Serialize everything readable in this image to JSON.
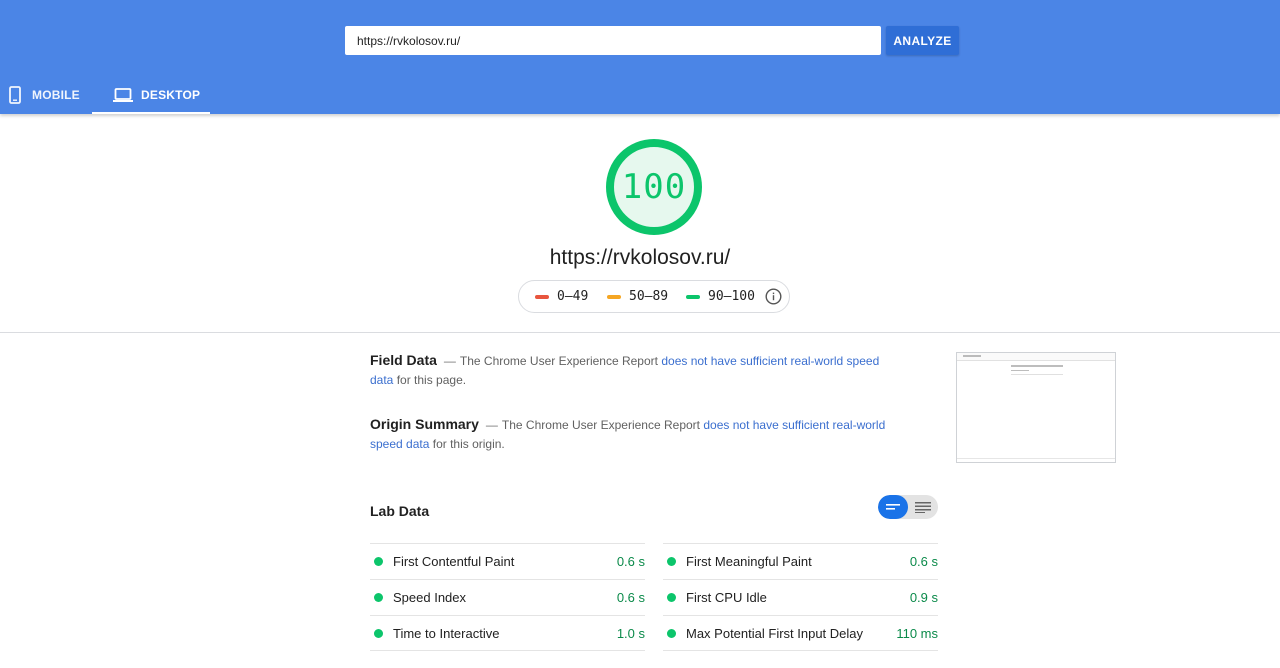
{
  "header": {
    "url_value": "https://rvkolosov.ru/",
    "analyze_label": "ANALYZE",
    "tabs": [
      {
        "label": "MOBILE",
        "icon": "smartphone-icon",
        "active": false
      },
      {
        "label": "DESKTOP",
        "icon": "laptop-icon",
        "active": true
      }
    ],
    "color": "#4b85e6"
  },
  "score": {
    "value": "100",
    "fraction": 1.0,
    "url": "https://rvkolosov.ru/",
    "color": "#0cc56b"
  },
  "legend": {
    "items": [
      {
        "label": "0–49",
        "color": "#e8553e"
      },
      {
        "label": "50–89",
        "color": "#f5a623"
      },
      {
        "label": "90–100",
        "color": "#0cc56b"
      }
    ],
    "info_icon": "info-icon"
  },
  "field_data": {
    "title": "Field Data",
    "dash": "—",
    "text_before": "The Chrome User Experience Report",
    "link": "does not have sufficient real-world speed data",
    "text_after": "for this page."
  },
  "origin_summary": {
    "title": "Origin Summary",
    "dash": "—",
    "text_before": "The Chrome User Experience Report",
    "link": "does not have sufficient real-world speed data",
    "text_after": "for this origin."
  },
  "lab_data": {
    "title": "Lab Data",
    "toggle_icons": [
      "compact-view-icon",
      "expanded-view-icon"
    ],
    "left_metrics": [
      {
        "name": "First Contentful Paint",
        "value": "0.6 s"
      },
      {
        "name": "Speed Index",
        "value": "0.6 s"
      },
      {
        "name": "Time to Interactive",
        "value": "1.0 s"
      }
    ],
    "right_metrics": [
      {
        "name": "First Meaningful Paint",
        "value": "0.6 s"
      },
      {
        "name": "First CPU Idle",
        "value": "0.9 s"
      },
      {
        "name": "Max Potential First Input Delay",
        "value": "110 ms"
      }
    ]
  }
}
